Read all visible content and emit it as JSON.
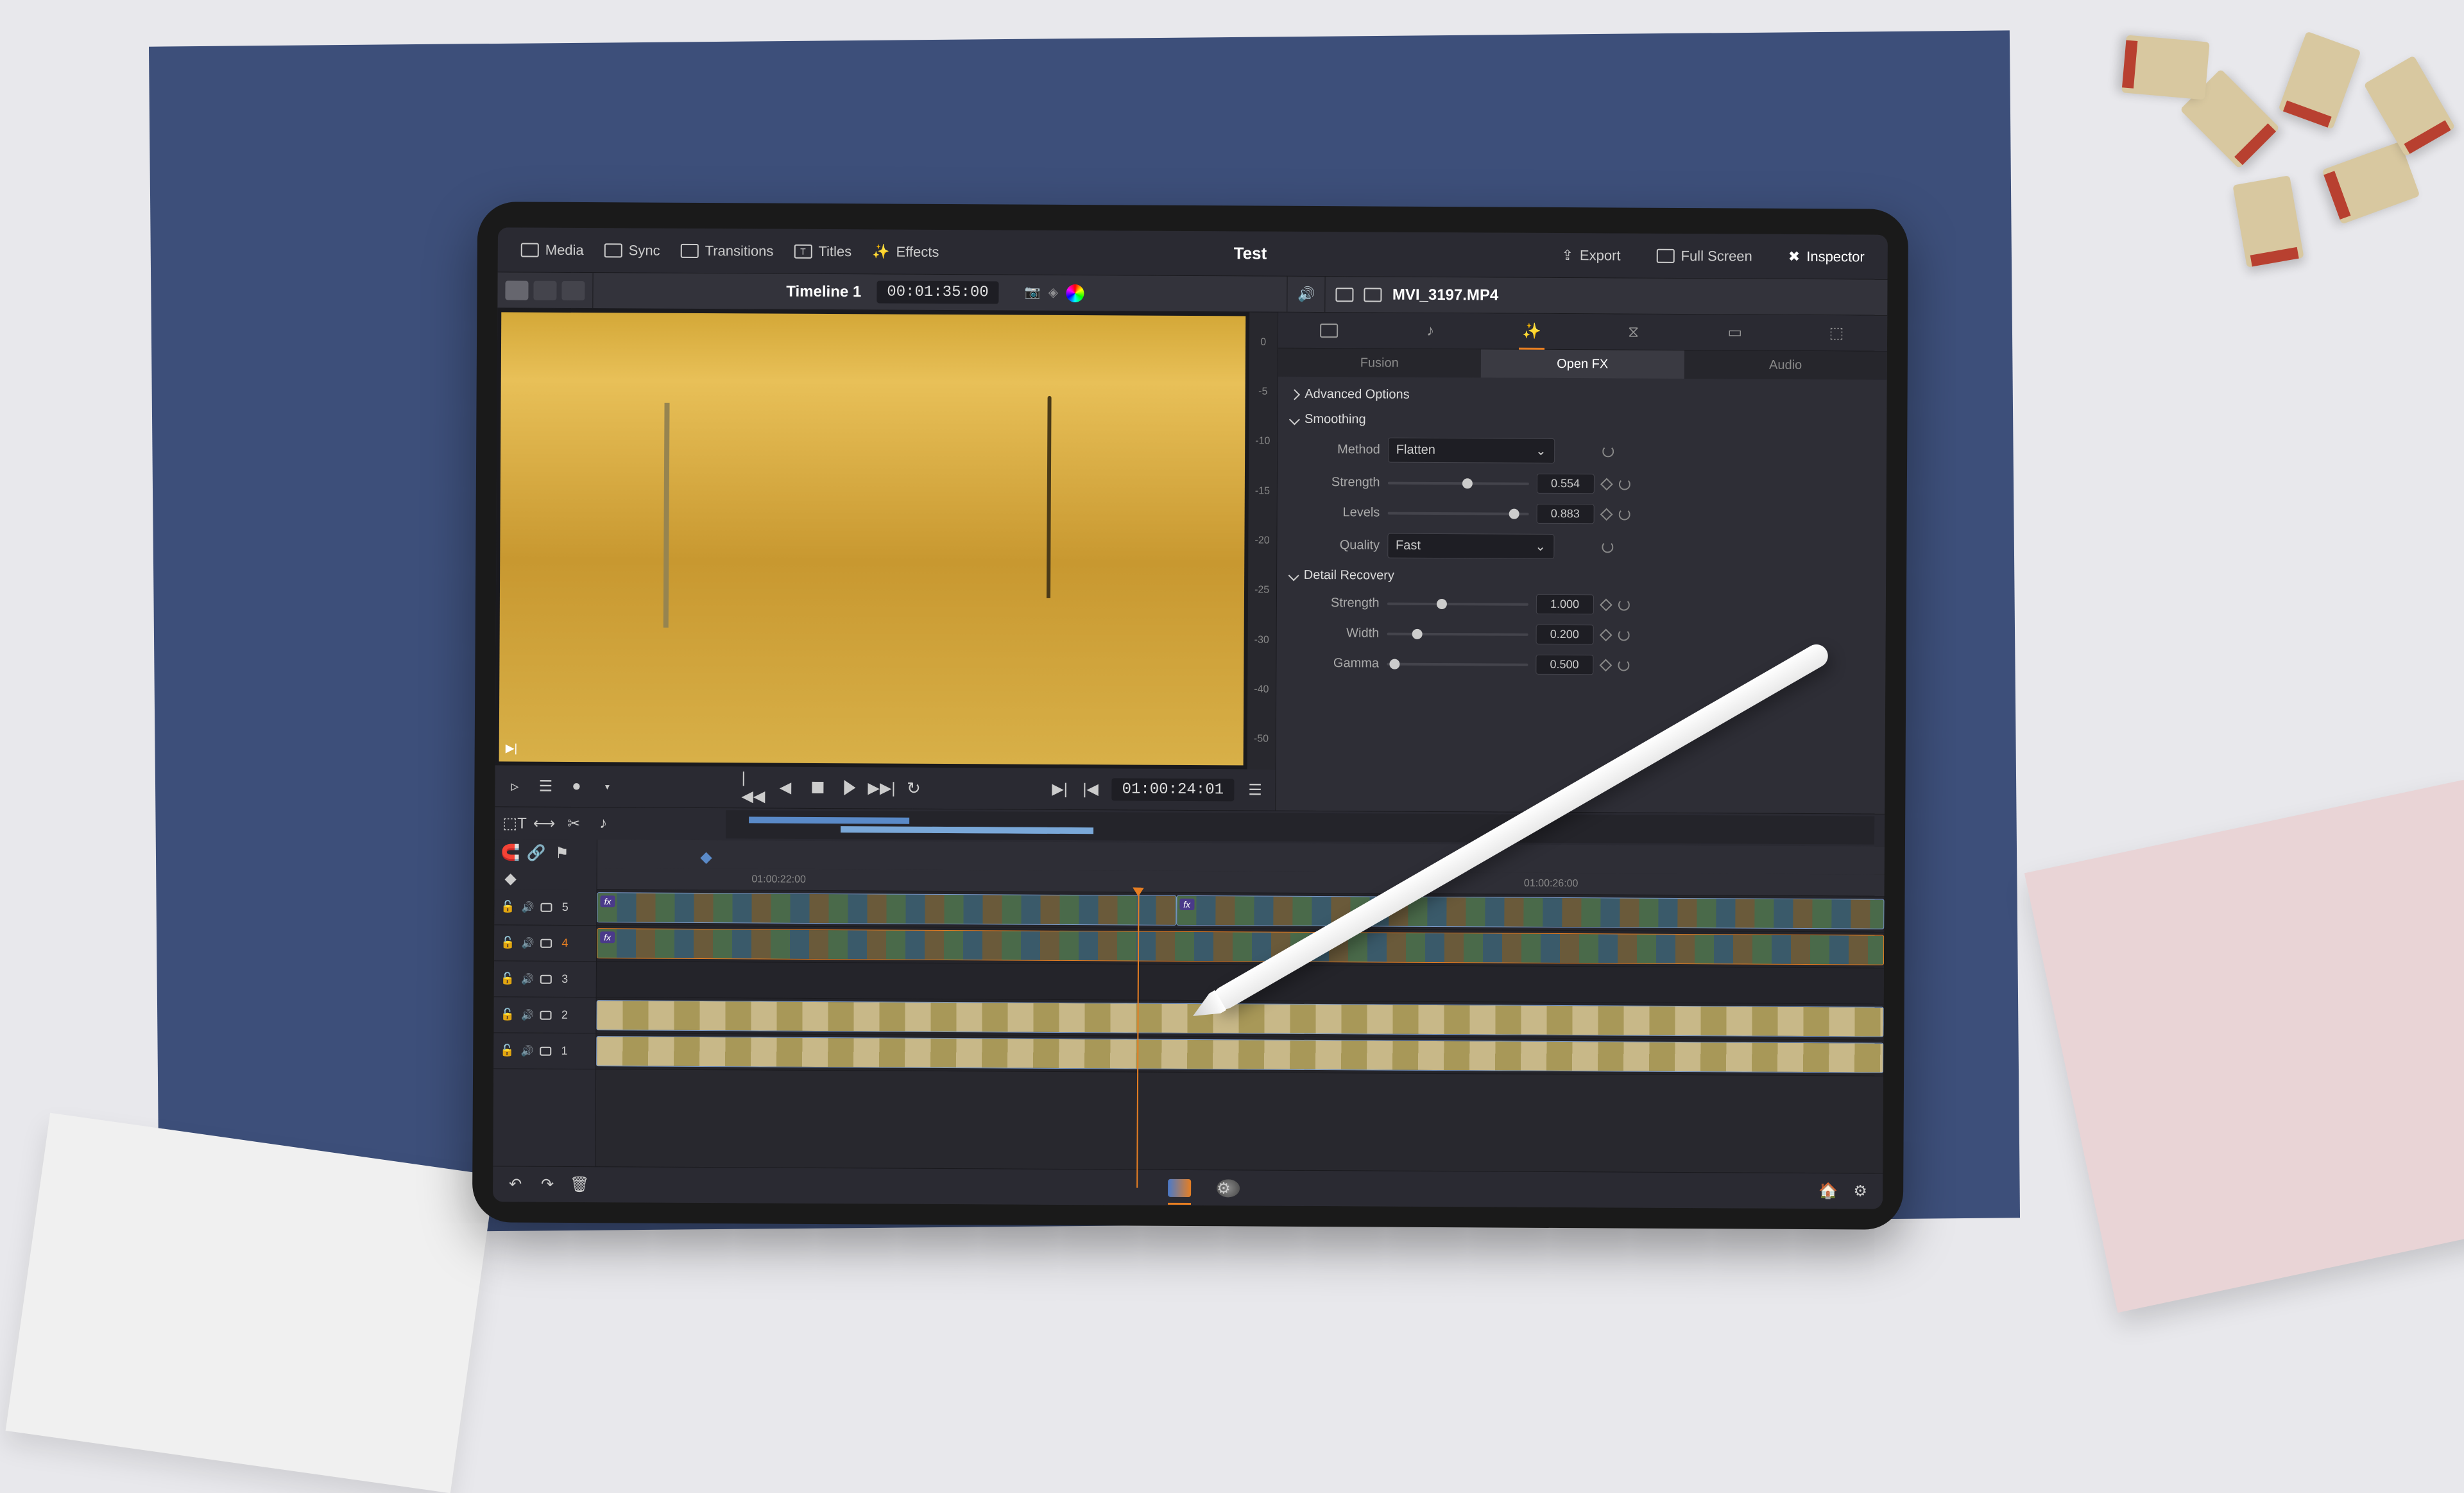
{
  "toolbar": {
    "media": "Media",
    "sync": "Sync",
    "transitions": "Transitions",
    "titles": "Titles",
    "effects": "Effects",
    "project_title": "Test",
    "export": "Export",
    "fullscreen": "Full Screen",
    "inspector": "Inspector"
  },
  "secbar": {
    "timeline_name": "Timeline 1",
    "timeline_tc": "00:01:35:00"
  },
  "audio_meter": [
    "0",
    "-5",
    "-10",
    "-15",
    "-20",
    "-25",
    "-30",
    "-40",
    "-50"
  ],
  "transport": {
    "viewer_tc": "01:00:24:01"
  },
  "inspector": {
    "clip_name": "MVI_3197.MP4",
    "subtabs": {
      "fusion": "Fusion",
      "openfx": "Open FX",
      "audio": "Audio"
    },
    "sections": {
      "advanced": "Advanced Options",
      "smoothing": "Smoothing",
      "detail": "Detail Recovery"
    },
    "params": {
      "method_label": "Method",
      "method_value": "Flatten",
      "strength_label": "Strength",
      "strength_value": "0.554",
      "levels_label": "Levels",
      "levels_value": "0.883",
      "quality_label": "Quality",
      "quality_value": "Fast",
      "d_strength_label": "Strength",
      "d_strength_value": "1.000",
      "d_width_label": "Width",
      "d_width_value": "0.200",
      "d_gamma_label": "Gamma",
      "d_gamma_value": "0.500"
    }
  },
  "timeline": {
    "ruler": {
      "t1": "01:00:22:00",
      "t2": "01:00:26:00"
    },
    "tracks": [
      "5",
      "4",
      "3",
      "2",
      "1"
    ],
    "tool_icons": [
      "arrow-icon",
      "blade-icon",
      "trim-icon",
      "snap-icon",
      "link-icon",
      "flag-icon",
      "marker-icon",
      "audio-tool-icon"
    ]
  },
  "icons": {
    "media": "media-pool-icon",
    "sync": "sync-bin-icon",
    "transitions": "transitions-icon",
    "titles": "titles-icon",
    "effects": "effects-wand-icon",
    "export": "export-icon",
    "fullscreen": "fullscreen-icon",
    "inspector": "inspector-tools-icon",
    "speaker": "speaker-icon",
    "undo": "undo-icon",
    "redo": "redo-icon",
    "trash": "trash-icon",
    "home": "home-icon",
    "settings": "gear-icon"
  }
}
